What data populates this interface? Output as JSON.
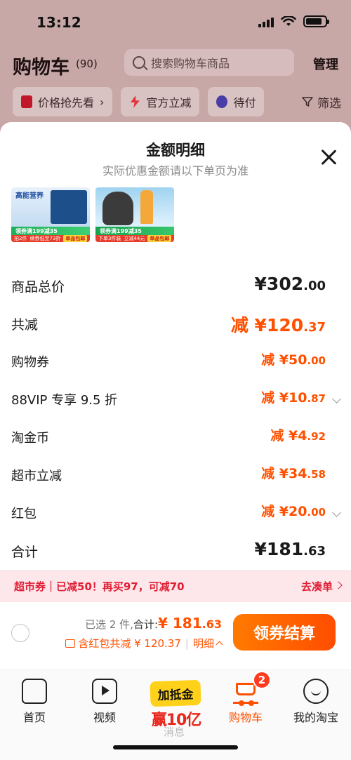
{
  "status": {
    "time": "13:12"
  },
  "header": {
    "title": "购物车",
    "count": "(90)",
    "search_placeholder": "搜索购物车商品",
    "manage": "管理"
  },
  "filters": {
    "chips": [
      "价格抢先看",
      "官方立减",
      "待付"
    ],
    "right": "筛选"
  },
  "sheet": {
    "title": "金额明细",
    "subtitle": "实际优惠金额请以下单页为准",
    "thumbs": [
      {
        "top_text": "高能营养",
        "band": "领券满199减35",
        "foot_1": "拍2件",
        "foot_2": "续券低至73折",
        "tag": "单品包邮"
      },
      {
        "top_text": "",
        "band": "领券满199减35",
        "foot_1": "下单3件装",
        "foot_2": "立减44元",
        "tag": "单品包邮"
      }
    ],
    "rows": [
      {
        "label": "商品总价",
        "prefix": "¥",
        "int": "302",
        "dec": ".00"
      },
      {
        "label": "共减",
        "prefix": "减 ¥",
        "int": "120",
        "dec": ".37"
      },
      {
        "label": "购物券",
        "prefix": "减 ¥",
        "int": "50",
        "dec": ".00"
      },
      {
        "label": "88VIP 专享 9.5 折",
        "prefix": "减 ¥",
        "int": "10",
        "dec": ".87"
      },
      {
        "label": "淘金币",
        "prefix": "减 ¥",
        "int": "4",
        "dec": ".92"
      },
      {
        "label": "超市立减",
        "prefix": "减 ¥",
        "int": "34",
        "dec": ".58"
      },
      {
        "label": "红包",
        "prefix": "减 ¥",
        "int": "20",
        "dec": ".00"
      },
      {
        "label": "合计",
        "prefix": "¥",
        "int": "181",
        "dec": ".63"
      }
    ],
    "promo_bar": {
      "text": "超市券｜已减50！再买97，可减70",
      "action": "去凑单"
    }
  },
  "checkout": {
    "selected": "已选 2 件,",
    "total_label": "合计:",
    "total_int": "¥ 181",
    "total_dec": ".63",
    "discount": "含红包共减 ¥ 120.37",
    "detail": "明细",
    "button": "领券结算"
  },
  "tabbar": {
    "items": [
      "首页",
      "视频",
      "购物车",
      "我的淘宝"
    ],
    "promo_top": "加抵金",
    "promo_bottom": "赢10亿",
    "promo_ghost": "消息",
    "cart_badge": "2"
  },
  "colors": {
    "accent": "#ff5000",
    "promo_red": "#e01e35",
    "overlay": "#c8a7a7"
  }
}
